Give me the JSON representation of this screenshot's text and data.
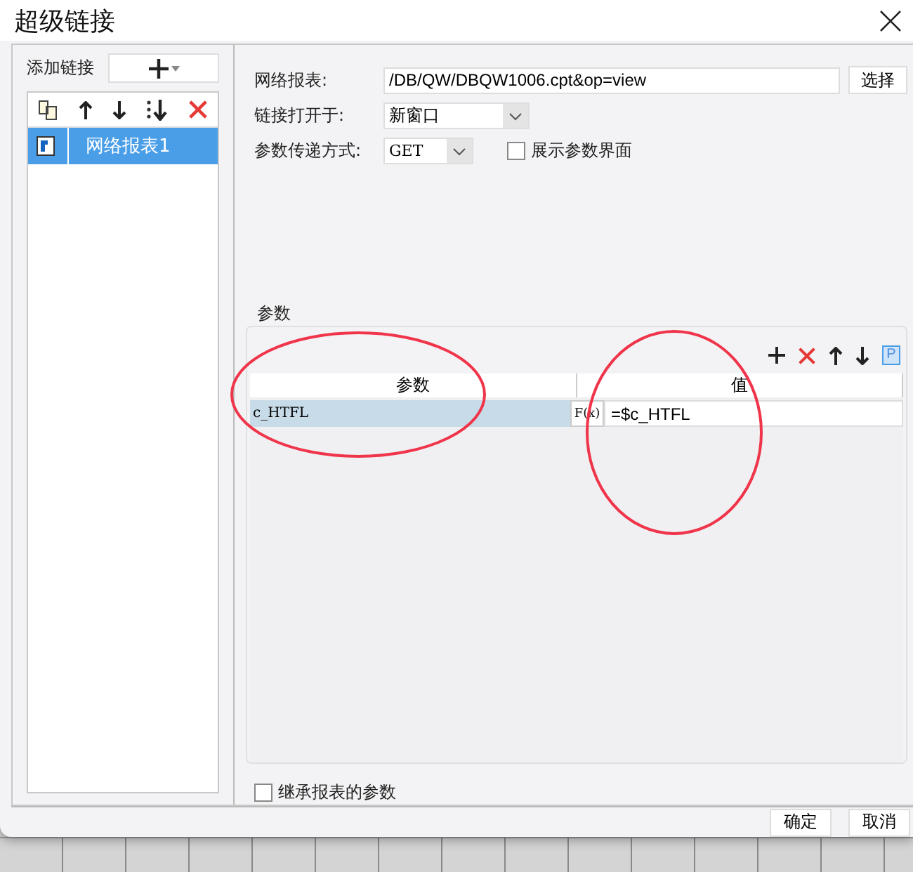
{
  "window": {
    "title": "超级链接"
  },
  "left_panel": {
    "label": "添加链接",
    "links": [
      {
        "label": "网络报表1",
        "selected": true
      }
    ]
  },
  "form": {
    "fields": [
      {
        "label": "网络报表:",
        "kind": "text",
        "value": "/DB/QW/DBQW1006.cpt&op=view",
        "button": "选择"
      },
      {
        "label": "链接打开于:",
        "kind": "select",
        "value": "新窗口"
      },
      {
        "label": "参数传递方式:",
        "kind": "select",
        "value": "GET",
        "checkbox": {
          "label": "展示参数界面",
          "checked": false
        }
      }
    ]
  },
  "params": {
    "title": "参数",
    "p_button": "P",
    "formula": "F(x)",
    "columns": [
      "参数",
      "值"
    ],
    "rows": [
      {
        "name": "c_HTFL",
        "value": "=$c_HTFL",
        "selected": true
      }
    ]
  },
  "inherit": {
    "label": "继承报表的参数",
    "checked": false
  },
  "buttons": [
    "确定",
    "取消"
  ]
}
